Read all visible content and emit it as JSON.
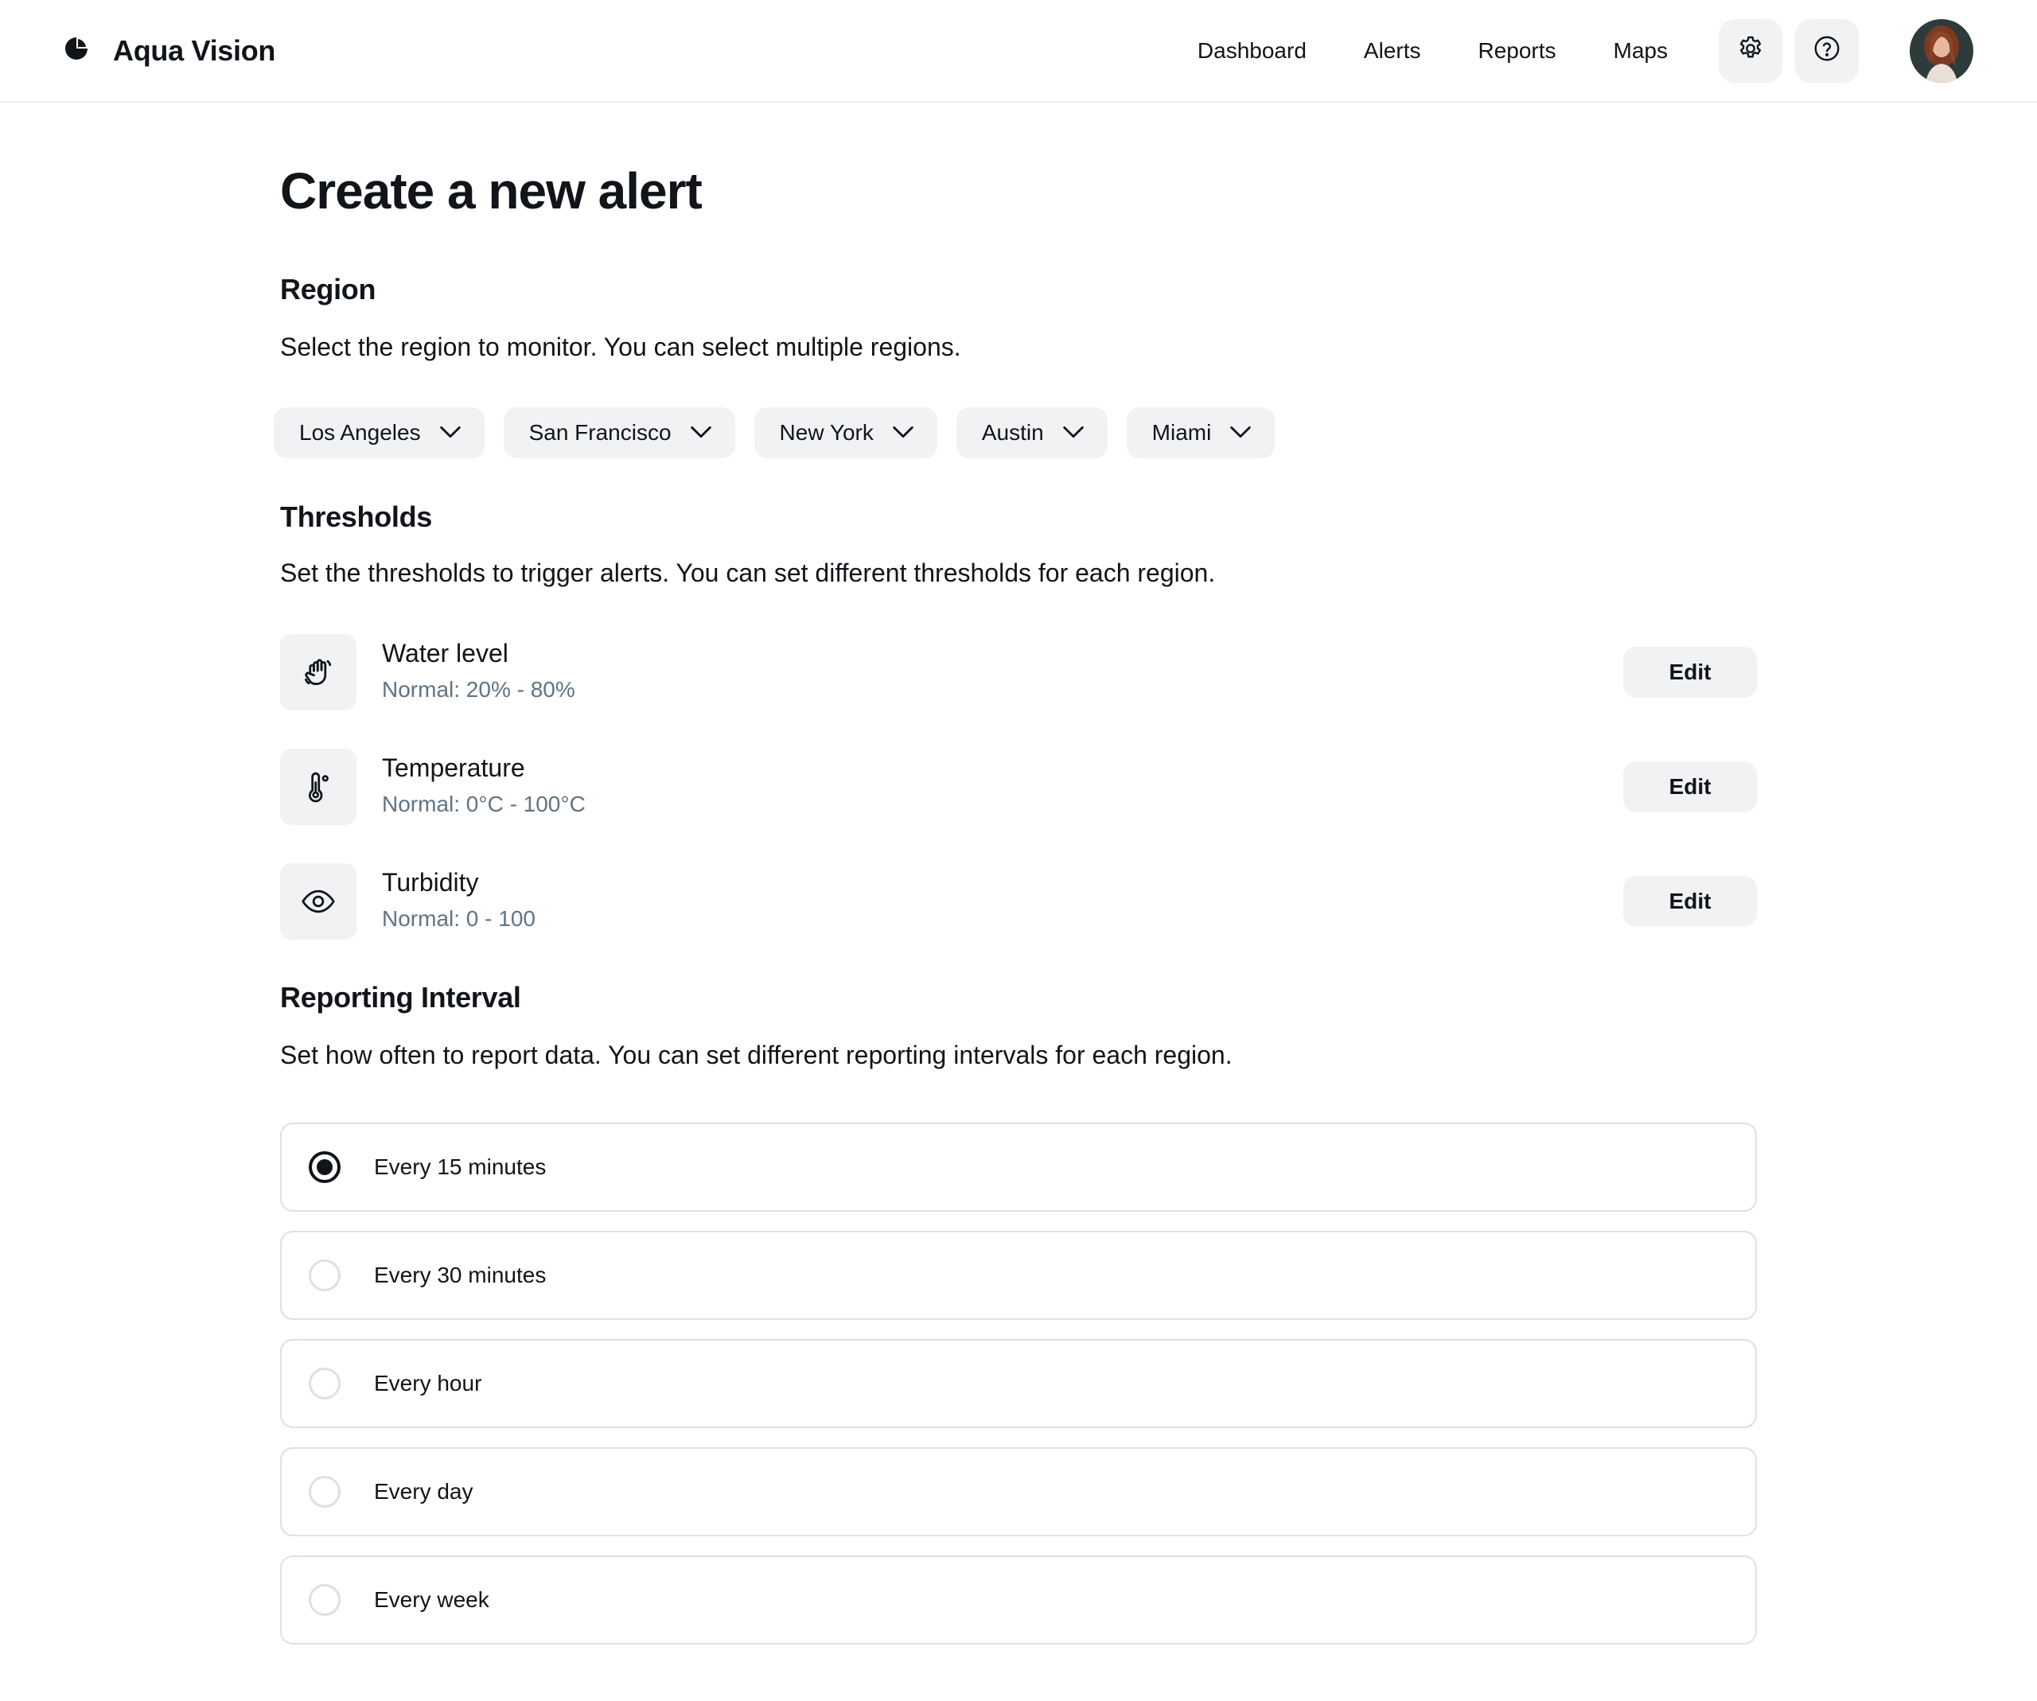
{
  "app": {
    "name": "Aqua Vision",
    "logo_icon": "aqua-vision-logo-icon"
  },
  "nav": {
    "links": [
      "Dashboard",
      "Alerts",
      "Reports",
      "Maps"
    ],
    "settings_icon": "gear-icon",
    "help_icon": "question-circle-icon"
  },
  "page": {
    "title": "Create a new alert"
  },
  "region": {
    "title": "Region",
    "description": "Select the region to monitor. You can select multiple regions.",
    "chips": [
      "Los Angeles",
      "San Francisco",
      "New York",
      "Austin",
      "Miami"
    ]
  },
  "thresholds": {
    "title": "Thresholds",
    "description": "Set the thresholds to trigger alerts. You can set different thresholds for each region.",
    "items": [
      {
        "name": "Water level",
        "normal": "Normal: 20% - 80%",
        "icon": "hand-wave-icon",
        "edit_label": "Edit"
      },
      {
        "name": "Temperature",
        "normal": "Normal: 0°C - 100°C",
        "icon": "thermometer-icon",
        "edit_label": "Edit"
      },
      {
        "name": "Turbidity",
        "normal": "Normal: 0 - 100",
        "icon": "eye-icon",
        "edit_label": "Edit"
      }
    ]
  },
  "reporting": {
    "title": "Reporting Interval",
    "description": "Set how often to report data. You can set different reporting intervals for each region.",
    "options": [
      "Every 15 minutes",
      "Every 30 minutes",
      "Every hour",
      "Every day",
      "Every week"
    ],
    "selected": "Every 15 minutes"
  },
  "colors": {
    "text": "#111418",
    "muted": "#5f7485",
    "chip_bg": "#f0f2f4",
    "border": "#dde1e5"
  }
}
